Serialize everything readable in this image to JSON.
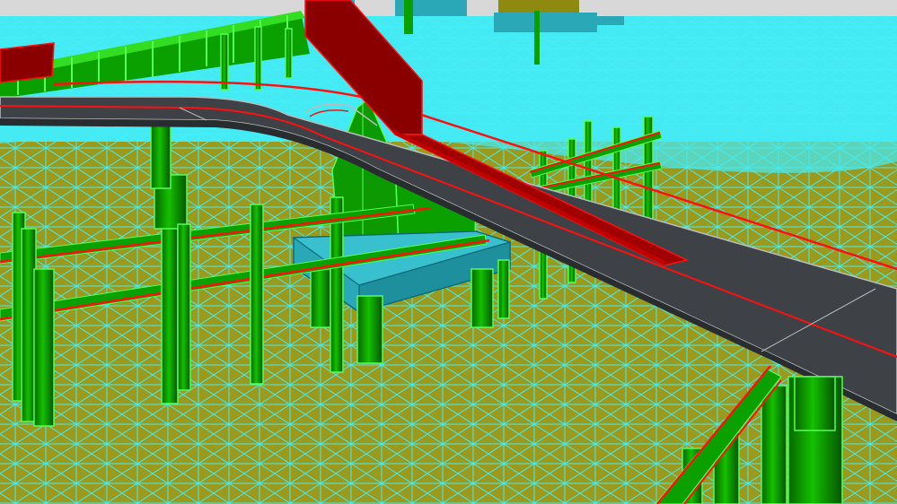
{
  "scene": {
    "kind": "3d-bim-wireframe-view",
    "colors": {
      "sky": "#d8d8d8",
      "terrain_fill": "#9a9a1e",
      "terrain_wire": "#3ff2ff",
      "roadway_surface": "#3e4246",
      "roadway_edge": "#b8bcc0",
      "red_member": "#8a0000",
      "red_line": "#ff1010",
      "green_pile": "#0aa000",
      "green_pile_dark": "#066600",
      "green_edge": "#55ff55",
      "pile_cap": "#2aa8b8",
      "pile_cap_edge": "#0a6a78",
      "wall_olive": "#8e8a10"
    },
    "objects": [
      {
        "name": "elevated-roadway",
        "icon": "road-deck"
      },
      {
        "name": "red-ramp-girder",
        "icon": "beam"
      },
      {
        "name": "red-pipeline",
        "icon": "pipe"
      },
      {
        "name": "green-pile-array",
        "icon": "column"
      },
      {
        "name": "pile-cap",
        "icon": "block"
      },
      {
        "name": "retaining-fence",
        "icon": "fence"
      },
      {
        "name": "terrain-mesh",
        "icon": "mesh"
      }
    ]
  }
}
